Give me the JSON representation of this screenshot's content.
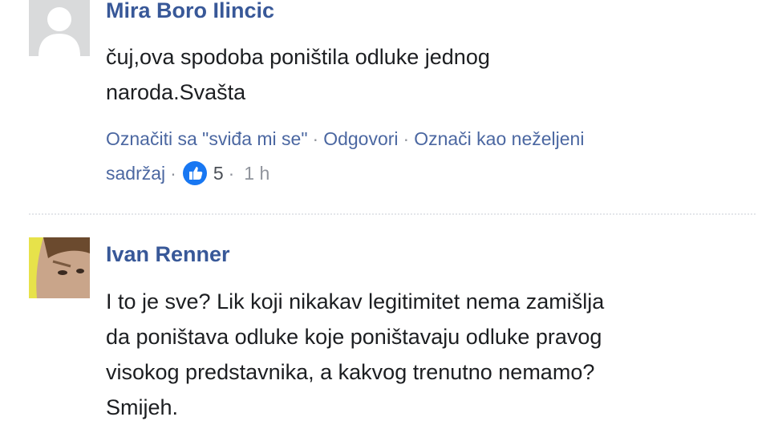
{
  "comments": [
    {
      "author": "Mira Boro Ilincic",
      "lines": [
        "čuj,ova spodoba poništila odluke jednog",
        "naroda.Svašta"
      ],
      "actions": {
        "like": "Označiti sa \"sviđa mi se\"",
        "reply": "Odgovori",
        "report_line1": "Označi kao neželjeni",
        "report_line2": "sadržaj",
        "separator": "·",
        "reaction_count": "5",
        "time": "1 h"
      }
    },
    {
      "author": "Ivan Renner",
      "lines": [
        "I to je sve? Lik koji nikakav legitimitet nema zamišlja",
        "da poništava odluke koje poništavaju odluke pravog",
        "visokog predstavnika, a kakvog trenutno nemamo?",
        "Smijeh."
      ]
    }
  ],
  "colors": {
    "author": "#385898",
    "action_link": "#4b67a1",
    "text": "#1c1e21",
    "like_blue": "#1877f2"
  },
  "icons": [
    "avatar-placeholder",
    "avatar-photo",
    "thumbs-up-icon"
  ]
}
